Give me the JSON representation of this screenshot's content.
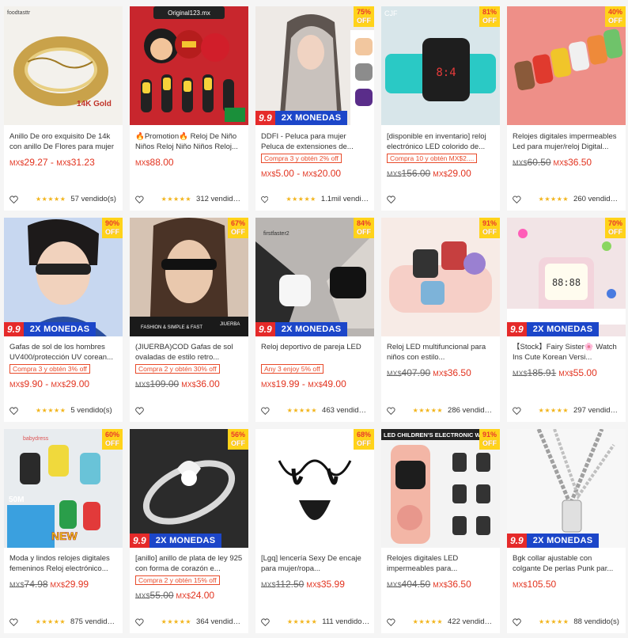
{
  "currency": "MX$",
  "products": [
    {
      "title": "Anillo De oro exquisito De 14k con anillo De Flores para mujer",
      "price": "29.27",
      "price2": "31.23",
      "old": "",
      "coupon": "",
      "discount": "",
      "promo": false,
      "stars": "★★★★★",
      "sold": "57 vendido(s)",
      "overlay": "14K Gold",
      "brand": "foodtasttr"
    },
    {
      "title": "🔥Promotion🔥 Reloj De Niño Niños Reloj Niño Niños Reloj...",
      "price": "88.00",
      "price2": "",
      "old": "",
      "coupon": "",
      "discount": "",
      "promo": false,
      "stars": "★★★★★",
      "sold": "312 vendido(s)",
      "overlay": "Original123.mx",
      "brand": ""
    },
    {
      "title": "DDFI - Peluca para mujer Peluca de extensiones de...",
      "price": "5.00",
      "price2": "20.00",
      "old": "",
      "coupon": "Compra 3 y obtén 2% off",
      "discount": "75%",
      "promo": true,
      "stars": "★★★★★",
      "sold": "1.1mil vendido(s)"
    },
    {
      "title": "[disponible en inventario] reloj electrónico LED colorido de...",
      "price": "29.00",
      "price2": "",
      "old": "156.00",
      "coupon": "Compra 10 y obtén MX$2....",
      "discount": "81%",
      "promo": false,
      "stars": "",
      "sold": ""
    },
    {
      "title": "Relojes digitales impermeables Led para mujer/reloj Digital...",
      "price": "36.50",
      "price2": "",
      "old": "60.50",
      "coupon": "",
      "discount": "40%",
      "promo": false,
      "stars": "★★★★★",
      "sold": "260 vendido(s)"
    },
    {
      "title": "Gafas de sol de los hombres UV400/protección UV corean...",
      "price": "9.90",
      "price2": "29.00",
      "old": "",
      "coupon": "Compra 3 y obtén 3% off",
      "discount": "90%",
      "promo": true,
      "stars": "★★★★★",
      "sold": "5 vendido(s)"
    },
    {
      "title": "(JIUERBA)COD Gafas de sol ovaladas de estilo retro...",
      "price": "36.00",
      "price2": "",
      "old": "109.00",
      "coupon": "Compra 2 y obtén 30% off",
      "discount": "67%",
      "promo": false,
      "stars": "",
      "sold": ""
    },
    {
      "title": "Reloj deportivo de pareja LED",
      "price": "19.99",
      "price2": "49.00",
      "old": "",
      "coupon": "Any 3 enjoy 5% off",
      "discount": "84%",
      "promo": true,
      "stars": "★★★★★",
      "sold": "463 vendido(s)"
    },
    {
      "title": "Reloj LED multifuncional para niños con estilo...",
      "price": "36.50",
      "price2": "",
      "old": "407.90",
      "coupon": "",
      "discount": "91%",
      "promo": false,
      "stars": "★★★★★",
      "sold": "286 vendido(s)"
    },
    {
      "title": "【Stock】Fairy Sister🌸 Watch Ins Cute Korean Versi...",
      "price": "55.00",
      "price2": "",
      "old": "185.91",
      "coupon": "",
      "discount": "70%",
      "promo": true,
      "stars": "★★★★★",
      "sold": "297 vendido(s)"
    },
    {
      "title": "Moda y lindos relojes digitales femeninos Reloj electrónico...",
      "price": "29.99",
      "price2": "",
      "old": "74.98",
      "coupon": "",
      "discount": "60%",
      "promo": false,
      "stars": "★★★★★",
      "sold": "875 vendido(s)"
    },
    {
      "title": "[anillo] anillo de plata de ley 925 con forma de corazón e...",
      "price": "24.00",
      "price2": "",
      "old": "55.00",
      "coupon": "Compra 2 y obtén 15% off",
      "discount": "56%",
      "promo": true,
      "stars": "★★★★★",
      "sold": "364 vendido(s)"
    },
    {
      "title": "[Lgq] lencería Sexy De encaje para mujer/ropa...",
      "price": "35.99",
      "price2": "",
      "old": "112.50",
      "coupon": "",
      "discount": "68%",
      "promo": false,
      "stars": "★★★★★",
      "sold": "111 vendido(s)"
    },
    {
      "title": "Relojes digitales LED impermeables para...",
      "price": "36.50",
      "price2": "",
      "old": "404.50",
      "coupon": "",
      "discount": "91%",
      "promo": false,
      "stars": "★★★★★",
      "sold": "422 vendido(s)",
      "overlay": "LED CHILDREN'S ELECTRONIC W"
    },
    {
      "title": "Bgk collar ajustable con colgante De perlas Punk par...",
      "price": "105.50",
      "price2": "",
      "old": "",
      "coupon": "",
      "discount": "",
      "promo": true,
      "stars": "★★★★★",
      "sold": "88 vendido(s)"
    }
  ],
  "labels": {
    "off": "OFF",
    "promo_num": "9.9",
    "promo_text": "2X MONEDAS",
    "fashion_banner": "FASHION & SIMPLE & FAST",
    "jiuerba": "JIUERBA",
    "firstfaster": "firstfaster2",
    "new_badge": "NEW",
    "m50": "50M",
    "babydress": "babydress",
    "cjf": "CJF"
  }
}
